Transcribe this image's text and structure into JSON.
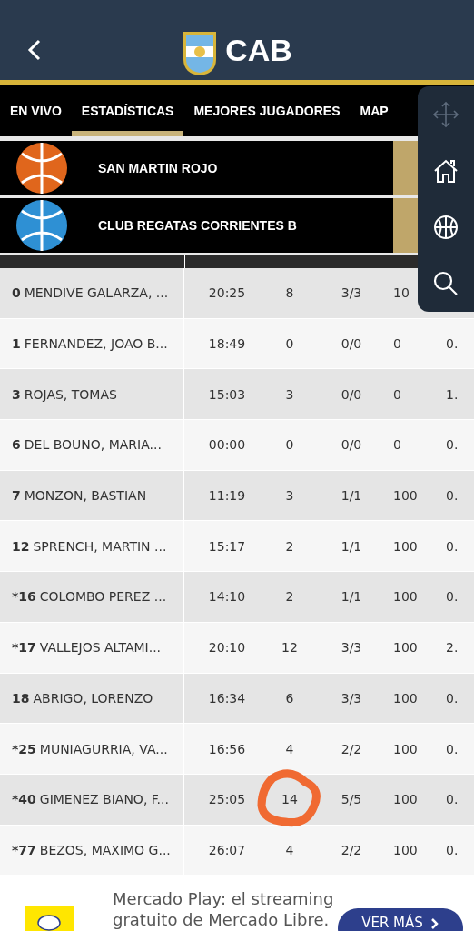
{
  "header": {
    "title": "CAB"
  },
  "tabs": [
    {
      "label": "EN VIVO",
      "selected": false
    },
    {
      "label": "ESTADÍSTICAS",
      "selected": true
    },
    {
      "label": "MEJORES JUGADORES",
      "selected": false
    },
    {
      "label": "MAP",
      "selected": false
    }
  ],
  "teams": [
    {
      "name": "SAN MARTIN ROJO",
      "color": "#e0661c"
    },
    {
      "name": "CLUB REGATAS CORRIENTES B",
      "color": "#2e90d4"
    }
  ],
  "rows": [
    {
      "number": "0",
      "name": "MENDIVE GALARZA, ...",
      "cells": [
        "20:25",
        "8",
        "3/3",
        "10"
      ],
      "circled": false
    },
    {
      "number": "1",
      "name": "FERNANDEZ, JOAO B...",
      "cells": [
        "18:49",
        "0",
        "0/0",
        "0",
        "0."
      ],
      "circled": false
    },
    {
      "number": "3",
      "name": "ROJAS, TOMAS",
      "cells": [
        "15:03",
        "3",
        "0/0",
        "0",
        "1."
      ],
      "circled": false
    },
    {
      "number": "6",
      "name": "DEL BOUNO, MARIA...",
      "cells": [
        "00:00",
        "0",
        "0/0",
        "0",
        "0."
      ],
      "circled": false
    },
    {
      "number": "7",
      "name": "MONZON, BASTIAN",
      "cells": [
        "11:19",
        "3",
        "1/1",
        "100",
        "0."
      ],
      "circled": false
    },
    {
      "number": "12",
      "name": "SPRENCH, MARTIN ...",
      "cells": [
        "15:17",
        "2",
        "1/1",
        "100",
        "0."
      ],
      "circled": false
    },
    {
      "number": "*16",
      "name": "COLOMBO PEREZ ...",
      "cells": [
        "14:10",
        "2",
        "1/1",
        "100",
        "0."
      ],
      "circled": false
    },
    {
      "number": "*17",
      "name": "VALLEJOS ALTAMI...",
      "cells": [
        "20:10",
        "12",
        "3/3",
        "100",
        "2."
      ],
      "circled": false
    },
    {
      "number": "18",
      "name": "ABRIGO, LORENZO",
      "cells": [
        "16:34",
        "6",
        "3/3",
        "100",
        "0."
      ],
      "circled": false
    },
    {
      "number": "*25",
      "name": "MUNIAGURRIA, VA...",
      "cells": [
        "16:56",
        "4",
        "2/2",
        "100",
        "0."
      ],
      "circled": false
    },
    {
      "number": "*40",
      "name": "GIMENEZ BIANO, F...",
      "cells": [
        "25:05",
        "14",
        "5/5",
        "100",
        "0."
      ],
      "circled": true
    },
    {
      "number": "*77",
      "name": "BEZOS, MAXIMO G...",
      "cells": [
        "26:07",
        "4",
        "2/2",
        "100",
        "0."
      ],
      "circled": false
    }
  ],
  "ad": {
    "text": "Mercado Play: el streaming gratuito de Mercado Libre.",
    "button": "VER MÁS"
  }
}
